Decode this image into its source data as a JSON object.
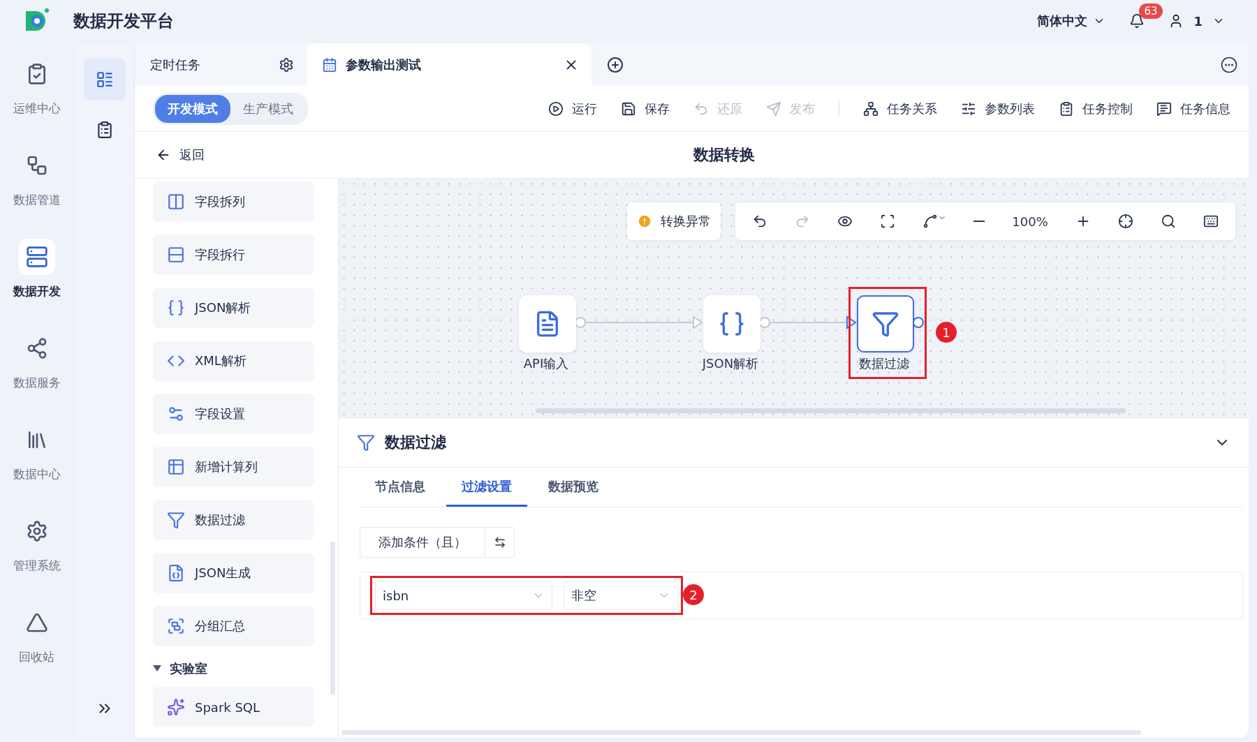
{
  "header": {
    "title": "数据开发平台",
    "language": "简体中文",
    "notifications": "63",
    "user": "1"
  },
  "nav": {
    "items": [
      {
        "label": "运维中心",
        "selected": false
      },
      {
        "label": "数据管道",
        "selected": false
      },
      {
        "label": "数据开发",
        "selected": true
      },
      {
        "label": "数据服务",
        "selected": false
      },
      {
        "label": "数据中心",
        "selected": false
      },
      {
        "label": "管理系统",
        "selected": false
      },
      {
        "label": "回收站",
        "selected": false
      }
    ]
  },
  "sub_nav": [
    {
      "selected": true
    },
    {
      "selected": false
    }
  ],
  "tabs": [
    {
      "label": "定时任务",
      "selected": false
    },
    {
      "label": "参数输出测试",
      "selected": true
    }
  ],
  "modes": [
    {
      "label": "开发模式",
      "selected": true
    },
    {
      "label": "生产模式",
      "selected": false
    }
  ],
  "toolbar": [
    {
      "label": "运行",
      "disabled": false
    },
    {
      "label": "保存",
      "disabled": false
    },
    {
      "label": "还原",
      "disabled": true
    },
    {
      "label": "发布",
      "disabled": true
    },
    {
      "label": "任务关系",
      "disabled": false
    },
    {
      "label": "参数列表",
      "disabled": false
    },
    {
      "label": "任务控制",
      "disabled": false
    },
    {
      "label": "任务信息",
      "disabled": false
    }
  ],
  "back": "返回",
  "page_title": "数据转换",
  "palette": {
    "items": [
      {
        "label": "字段拆列"
      },
      {
        "label": "字段拆行"
      },
      {
        "label": "JSON解析"
      },
      {
        "label": "XML解析"
      },
      {
        "label": "字段设置"
      },
      {
        "label": "新增计算列"
      },
      {
        "label": "数据过滤"
      },
      {
        "label": "JSON生成"
      },
      {
        "label": "分组汇总"
      }
    ],
    "section": {
      "label": "实验室",
      "expanded": true,
      "items": [
        {
          "label": "Spark SQL"
        }
      ]
    }
  },
  "canvas": {
    "status": "转换异常",
    "zoom": "100%",
    "nodes": [
      {
        "label": "API输入",
        "selected": false
      },
      {
        "label": "JSON解析",
        "selected": false
      },
      {
        "label": "数据过滤",
        "selected": true
      }
    ],
    "callout": "1"
  },
  "detail": {
    "title": "数据过滤",
    "tabs": [
      {
        "label": "节点信息",
        "selected": false
      },
      {
        "label": "过滤设置",
        "selected": true
      },
      {
        "label": "数据预览",
        "selected": false
      }
    ],
    "add_condition": "添加条件（且）",
    "conditions": [
      {
        "field": "isbn",
        "operator": "非空"
      }
    ],
    "callout": "2"
  }
}
